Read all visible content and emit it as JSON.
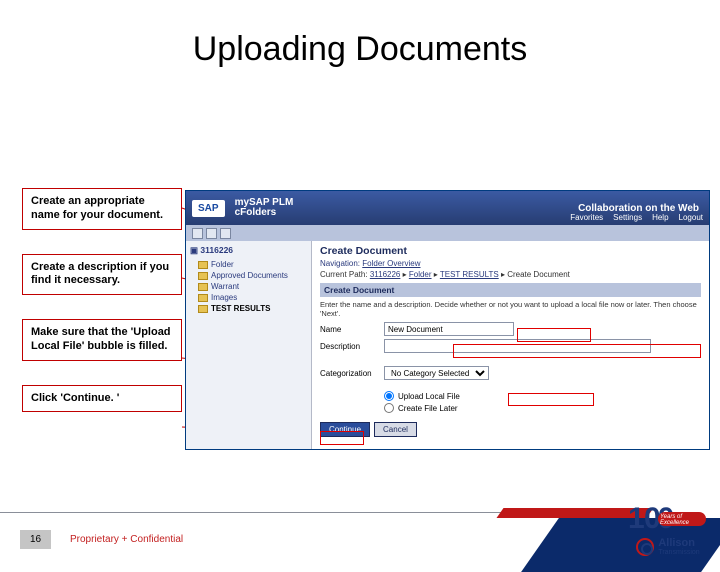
{
  "slide": {
    "title": "Uploading Documents",
    "page_number": "16",
    "confidential": "Proprietary + Confidential"
  },
  "callouts": {
    "c1": "Create an appropriate name for your document.",
    "c2": "Create a description if you find it necessary.",
    "c3": "Make sure that the 'Upload Local File' bubble is filled.",
    "c4": "Click 'Continue. '"
  },
  "app": {
    "sap": "SAP",
    "suite1": "mySAP PLM",
    "suite2": "cFolders",
    "tagline": "Collaboration on the Web",
    "nav": {
      "fav": "Favorites",
      "set": "Settings",
      "help": "Help",
      "logout": "Logout"
    }
  },
  "tree": {
    "root": "3116226",
    "items": [
      "Folder",
      "Approved Documents",
      "Warrant",
      "Images",
      "TEST RESULTS"
    ]
  },
  "panel": {
    "title": "Create Document",
    "nav_label": "Navigation:",
    "nav_link": "Folder Overview",
    "path_label": "Current Path:",
    "path_parts": {
      "p1": "3116226",
      "p2": "Folder",
      "p3": "TEST RESULTS",
      "p4": "Create Document"
    },
    "section": "Create Document",
    "hint": "Enter the name and a description. Decide whether or not you want to upload a local file now or later. Then choose 'Next'.",
    "name_label": "Name",
    "name_value": "New Document",
    "desc_label": "Description",
    "desc_value": "",
    "cat_label": "Categorization",
    "cat_value": "No Category Selected",
    "radio1": "Upload Local File",
    "radio2": "Create File Later",
    "btn_continue": "Continue",
    "btn_cancel": "Cancel",
    "triangle": "▸"
  },
  "brand": {
    "ribbon": "Years of Excellence",
    "name": "Allison",
    "sub": "Transmission"
  }
}
